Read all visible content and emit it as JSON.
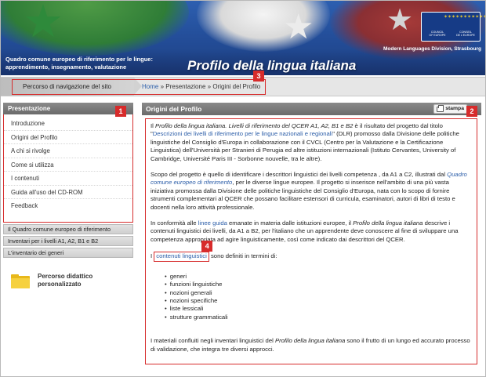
{
  "header": {
    "subtitle_line1": "Quadro comune europeo di riferimento per le lingue:",
    "subtitle_line2": "apprendimento, insegnamento, valutazione",
    "page_title": "Profilo della lingua italiana",
    "division": "Modern Languages Division, Strasbourg",
    "logo": {
      "en_line1": "COUNCIL",
      "en_line2": "OF EUROPE",
      "fr_line1": "CONSEIL",
      "fr_line2": "DE L'EUROPE",
      "stars": "✶✶✶✶✶✶✶✶✶✶✶✶"
    }
  },
  "nav": {
    "path_label": "Percorso di navigazione del sito",
    "crumb_home": "Home",
    "crumb_sep1": " » ",
    "crumb_2": "Presentazione",
    "crumb_sep2": " » ",
    "crumb_3": "Origini del Profilo"
  },
  "badges": {
    "b1": "1",
    "b2": "2",
    "b3": "3",
    "b4": "4"
  },
  "sidebar": {
    "title": "Presentazione",
    "items": [
      {
        "label": "Introduzione"
      },
      {
        "label": "Origini del Profilo"
      },
      {
        "label": "A chi si rivolge"
      },
      {
        "label": "Come si utilizza"
      },
      {
        "label": "I contenuti"
      },
      {
        "label": "Guida all'uso del CD-ROM"
      },
      {
        "label": "Feedback"
      }
    ],
    "sections": [
      {
        "label": "Il Quadro comune europeo di riferimento"
      },
      {
        "label": "Inventari per i livelli A1, A2, B1 e B2"
      },
      {
        "label": "L'inventario dei generi"
      }
    ],
    "promo_line1": "Percorso didattico",
    "promo_line2": "personalizzato"
  },
  "main": {
    "title": "Origini del Profilo",
    "print_label": "stampa",
    "p1_a": "Il ",
    "p1_em1": "Profilo della lingua italiana. Livelli di riferimento del QCER A1, A2, B1 e B2",
    "p1_b": " è il risultato del progetto dal titolo \"",
    "p1_link": "Descrizioni dei livelli di riferimento per le lingue nazionali e regionali",
    "p1_c": "\" (DLR) promosso dalla Divisione delle politiche linguistiche del Consiglio d'Europa in collaborazione con il CVCL (Centro per la Valutazione e la Certificazione Linguistica) dell'Università per Stranieri di Perugia ed altre istituzioni internazionali (Istituto Cervantes, University of Cambridge, Université Paris III - Sorbonne nouvelle, tra le altre).",
    "p2_a": "Scopo del progetto è quello di identificare i descrittori linguistici dei livelli competenza , da A1 a C2, illustrati dal ",
    "p2_link": "Quadro comune europeo di riferimento",
    "p2_b": ", per le diverse lingue europee. Il progetto si inserisce nell'ambito di una più vasta iniziativa promossa dalla Divisione delle politiche linguistiche del Consiglio d'Europa, nata con lo scopo di fornire strumenti complementari al QCER che possano facilitare estensori di curricula, esaminatori, autori di libri di testo e docenti nella loro attività professionale.",
    "p3_a": "In conformità alle ",
    "p3_link": "linee guida",
    "p3_b": " emanate in materia dalle istituzioni europee, il ",
    "p3_em": "Profilo della lingua italiana",
    "p3_c": " descrive i contenuti linguistici dei livelli, da A1 a B2, per l'italiano che un apprendente deve conoscere al fine di sviluppare una competenza appropriata ad agire linguisticamente, così come indicato dai descrittori del QCER.",
    "p4_a": "I ",
    "p4_link": "contenuti linguistici",
    "p4_b": " sono definiti in termini di:",
    "list": [
      {
        "text": "generi"
      },
      {
        "text": "funzioni linguistiche"
      },
      {
        "text": "nozioni generali"
      },
      {
        "text": "nozioni specifiche"
      },
      {
        "text": "liste lessicali"
      },
      {
        "text": "strutture grammaticali"
      }
    ],
    "p5_a": "I materiali confluiti negli inventari linguistici del ",
    "p5_em": "Profilo della lingua italiana",
    "p5_b": " sono il frutto di un lungo ed accurato processo di validazione, che integra tre diversi approcci."
  },
  "colors": {
    "highlight": "#d72b2b",
    "link": "#2b5da8",
    "panel_header": "#7a7a7a",
    "banner_blue": "#244f9b"
  }
}
